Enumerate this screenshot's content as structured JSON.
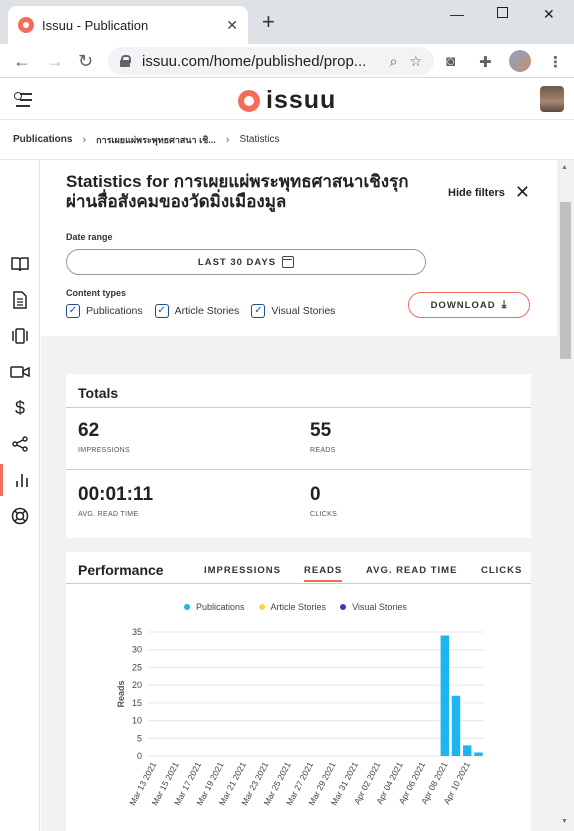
{
  "browser": {
    "tab_title": "Issuu - Publication",
    "url": "issuu.com/home/published/prop..."
  },
  "breadcrumb": {
    "item1": "Publications",
    "item2": "การเผยแผ่พระพุทธศาสนา เชิ...",
    "item3": "Statistics"
  },
  "app": {
    "logo": "issuu"
  },
  "filters": {
    "title": "Statistics for การเผยแผ่พระพุทธศาสนาเชิงรุกผ่านสื่อสังคมของวัดมิ่งเมืองมูล",
    "hide_filters": "Hide filters",
    "date_range_label": "Date range",
    "date_range_value": "LAST 30 DAYS",
    "content_types_label": "Content types",
    "content_types": [
      "Publications",
      "Article Stories",
      "Visual Stories"
    ],
    "download": "DOWNLOAD"
  },
  "totals": {
    "title": "Totals",
    "impressions": "62",
    "impressions_label": "IMPRESSIONS",
    "reads": "55",
    "reads_label": "READS",
    "avg_read_time": "00:01:11",
    "avg_read_time_label": "AVG. READ TIME",
    "clicks": "0",
    "clicks_label": "CLICKS"
  },
  "performance": {
    "title": "Performance",
    "tabs": [
      "IMPRESSIONS",
      "READS",
      "AVG. READ TIME",
      "CLICKS"
    ],
    "active_tab": "READS"
  },
  "colors": {
    "accent": "#f36d5d",
    "publications": "#1cb5f0",
    "article_stories": "#f5d63d",
    "visual_stories": "#4a2fc0"
  },
  "chart_data": {
    "type": "bar",
    "legend": [
      "Publications",
      "Article Stories",
      "Visual Stories"
    ],
    "ylabel": "Reads",
    "xlabel": "",
    "ylim": [
      0,
      35
    ],
    "yticks": [
      0,
      5,
      10,
      15,
      20,
      25,
      30,
      35
    ],
    "categories": [
      "Mar 13 2021",
      "Mar 14 2021",
      "Mar 15 2021",
      "Mar 16 2021",
      "Mar 17 2021",
      "Mar 18 2021",
      "Mar 19 2021",
      "Mar 20 2021",
      "Mar 21 2021",
      "Mar 22 2021",
      "Mar 23 2021",
      "Mar 24 2021",
      "Mar 25 2021",
      "Mar 26 2021",
      "Mar 27 2021",
      "Mar 28 2021",
      "Mar 29 2021",
      "Mar 30 2021",
      "Mar 31 2021",
      "Apr 01 2021",
      "Apr 02 2021",
      "Apr 03 2021",
      "Apr 04 2021",
      "Apr 05 2021",
      "Apr 06 2021",
      "Apr 07 2021",
      "Apr 08 2021",
      "Apr 09 2021",
      "Apr 10 2021",
      "Apr 11 2021"
    ],
    "tick_labels": [
      "Mar 13 2021",
      "Mar 15 2021",
      "Mar 17 2021",
      "Mar 19 2021",
      "Mar 21 2021",
      "Mar 23 2021",
      "Mar 25 2021",
      "Mar 27 2021",
      "Mar 29 2021",
      "Mar 31 2021",
      "Apr 02 2021",
      "Apr 04 2021",
      "Apr 06 2021",
      "Apr 08 2021",
      "Apr 10 2021"
    ],
    "series": [
      {
        "name": "Publications",
        "values": [
          0,
          0,
          0,
          0,
          0,
          0,
          0,
          0,
          0,
          0,
          0,
          0,
          0,
          0,
          0,
          0,
          0,
          0,
          0,
          0,
          0,
          0,
          0,
          0,
          0,
          0,
          34,
          17,
          3,
          1
        ]
      },
      {
        "name": "Article Stories",
        "values": [
          0,
          0,
          0,
          0,
          0,
          0,
          0,
          0,
          0,
          0,
          0,
          0,
          0,
          0,
          0,
          0,
          0,
          0,
          0,
          0,
          0,
          0,
          0,
          0,
          0,
          0,
          0,
          0,
          0,
          0
        ]
      },
      {
        "name": "Visual Stories",
        "values": [
          0,
          0,
          0,
          0,
          0,
          0,
          0,
          0,
          0,
          0,
          0,
          0,
          0,
          0,
          0,
          0,
          0,
          0,
          0,
          0,
          0,
          0,
          0,
          0,
          0,
          0,
          0,
          0,
          0,
          0
        ]
      }
    ]
  }
}
